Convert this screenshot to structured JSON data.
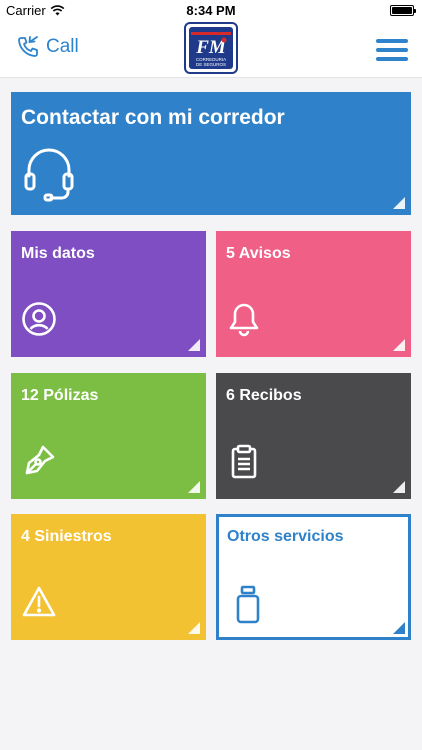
{
  "status_bar": {
    "carrier": "Carrier",
    "time": "8:34 PM"
  },
  "header": {
    "call_label": "Call",
    "logo_text": "CORREDURIA DE SEGUROS",
    "call_icon": "phone-icon",
    "menu_icon": "hamburger-menu-icon"
  },
  "tiles": [
    {
      "id": "contact",
      "label": "Contactar con mi corredor",
      "icon": "headset-icon",
      "color": "#2f82c9"
    },
    {
      "id": "datos",
      "label": "Mis datos",
      "icon": "user-circle-icon",
      "color": "#7f4ec3"
    },
    {
      "id": "avisos",
      "label": "5 Avisos",
      "icon": "bell-icon",
      "color": "#ef5f86"
    },
    {
      "id": "polizas",
      "label": "12 Pólizas",
      "icon": "pen-nib-icon",
      "color": "#7cbe43"
    },
    {
      "id": "recibos",
      "label": "6 Recibos",
      "icon": "clipboard-icon",
      "color": "#4a4a4c"
    },
    {
      "id": "siniestros",
      "label": "4 Siniestros",
      "icon": "warning-icon",
      "color": "#f2c232"
    },
    {
      "id": "otros",
      "label": "Otros servicios",
      "icon": "jar-icon",
      "color": "#2f82c9"
    }
  ]
}
